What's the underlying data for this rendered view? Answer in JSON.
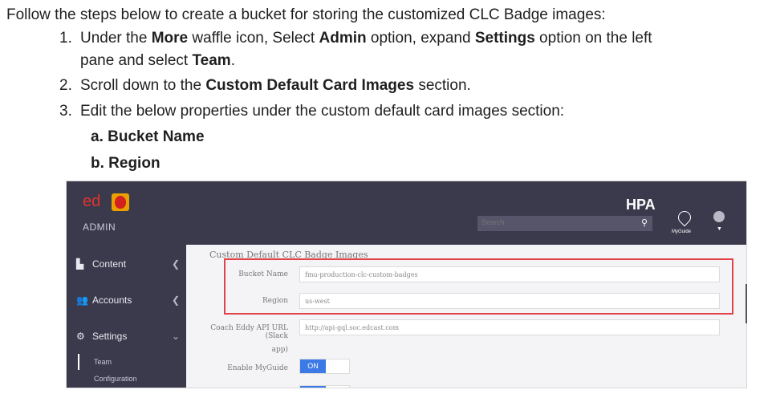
{
  "doc": {
    "intro": "Follow the steps below to create a bucket for storing the customized CLC Badge images:",
    "step1": {
      "num": "1.",
      "pre": "Under the ",
      "b1": "More",
      "mid1": " waffle icon, Select ",
      "b2": "Admin",
      "mid2": " option, expand ",
      "b3": "Settings",
      "mid3": " option on the left",
      "cont_pre": "pane and select ",
      "b4": "Team",
      "cont_post": "."
    },
    "step2": {
      "num": "2.",
      "pre": "Scroll down to the ",
      "b1": "Custom Default Card Images",
      "post": " section."
    },
    "step3": {
      "num": "3.",
      "text": "Edit the below properties under the custom default card images section:"
    },
    "sub_a": "a.   Bucket Name",
    "sub_b": "b.   Region"
  },
  "app": {
    "logo_ed": "ed",
    "admin_label": "ADMIN",
    "hpa": "HPA",
    "search_placeholder": "Search",
    "myguide_label": "MyGuide",
    "sidebar": [
      {
        "icon": "▙",
        "label": "Content"
      },
      {
        "icon": "👥",
        "label": "Accounts"
      },
      {
        "icon": "⚙",
        "label": "Settings"
      }
    ],
    "sidebar_sub": [
      "Team",
      "Configuration"
    ],
    "section_title": "Custom Default CLC Badge Images",
    "fields": {
      "bucket_label": "Bucket Name",
      "bucket_value": "fmu-production-clc-custom-badges",
      "region_label": "Region",
      "region_value": "us-west",
      "coach_label1": "Coach Eddy API URL (Slack",
      "coach_label2": "app)",
      "coach_value": "http://api-gql.soc.edcast.com",
      "myguide_label": "Enable MyGuide",
      "toggle_on": "ON"
    }
  }
}
